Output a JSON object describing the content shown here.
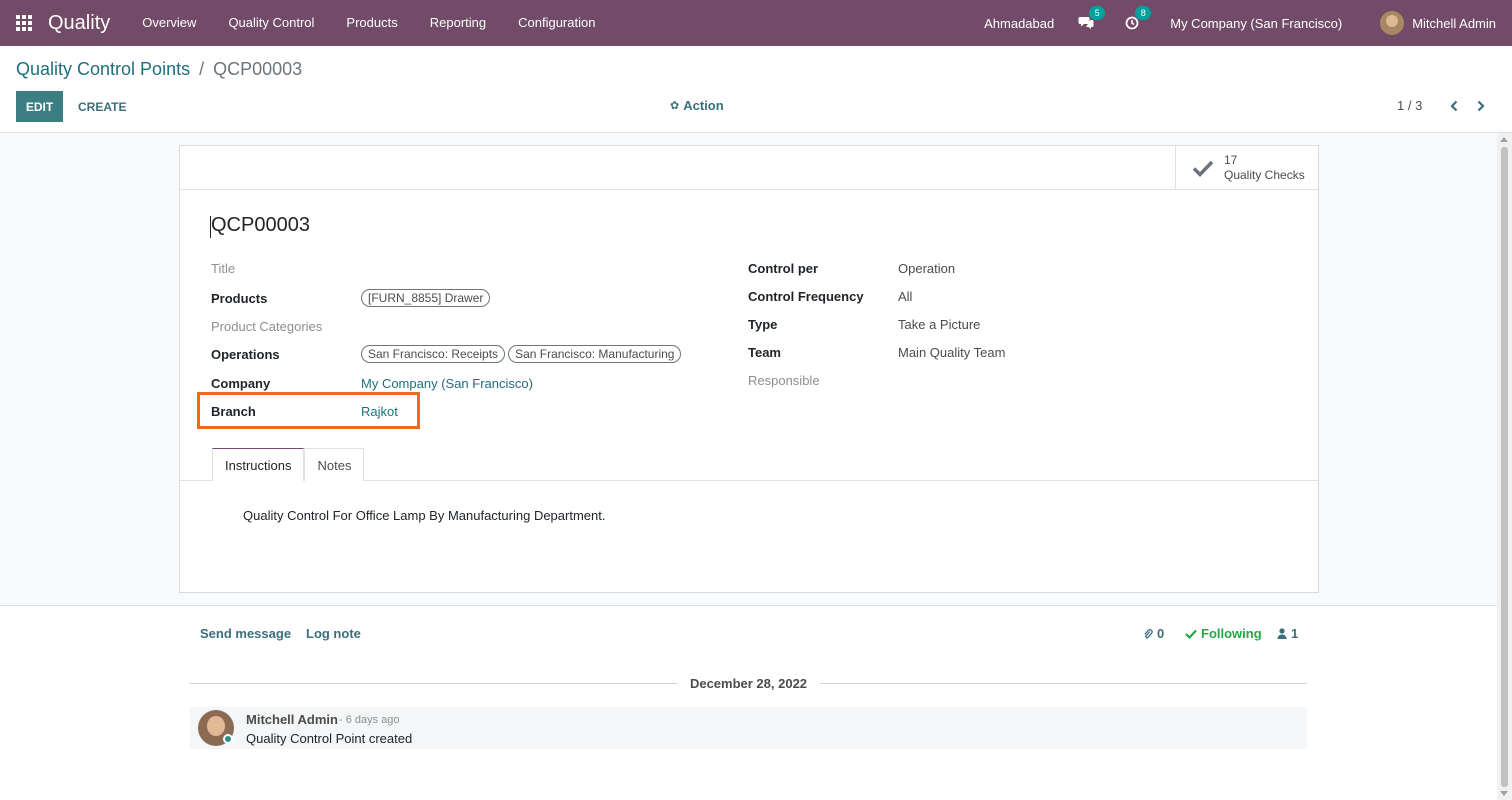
{
  "navbar": {
    "app_name": "Quality",
    "menu": [
      "Overview",
      "Quality Control",
      "Products",
      "Reporting",
      "Configuration"
    ],
    "branch": "Ahmadabad",
    "messages_count": "5",
    "activities_count": "8",
    "company": "My Company (San Francisco)",
    "user": "Mitchell Admin"
  },
  "control_panel": {
    "breadcrumb_parent": "Quality Control Points",
    "breadcrumb_sep": "/",
    "breadcrumb_current": "QCP00003",
    "edit_label": "EDIT",
    "create_label": "CREATE",
    "action_label": "Action",
    "pager": "1 / 3"
  },
  "stat_button": {
    "count": "17",
    "label": "Quality Checks"
  },
  "record": {
    "name": "QCP00003",
    "left_fields": {
      "title_label": "Title",
      "products_label": "Products",
      "products_tags": [
        "[FURN_8855] Drawer"
      ],
      "categories_label": "Product Categories",
      "operations_label": "Operations",
      "operations_tags": [
        "San Francisco: Receipts",
        "San Francisco: Manufacturing"
      ],
      "company_label": "Company",
      "company_value": "My Company (San Francisco)",
      "branch_label": "Branch",
      "branch_value": "Rajkot"
    },
    "right_fields": {
      "control_per_label": "Control per",
      "control_per_value": "Operation",
      "frequency_label": "Control Frequency",
      "frequency_value": "All",
      "type_label": "Type",
      "type_value": "Take a Picture",
      "team_label": "Team",
      "team_value": "Main Quality Team",
      "responsible_label": "Responsible"
    },
    "tabs": [
      "Instructions",
      "Notes"
    ],
    "instructions": "Quality Control For Office Lamp By Manufacturing Department."
  },
  "chatter": {
    "send_message": "Send message",
    "log_note": "Log note",
    "attachments": "0",
    "following": "Following",
    "followers": "1",
    "date": "December 28, 2022",
    "message": {
      "author": "Mitchell Admin",
      "time": "- 6 days ago",
      "body": "Quality Control Point created"
    }
  },
  "colors": {
    "navbar": "#714b67",
    "accent": "#3b7f85",
    "highlight": "#f06a1d",
    "following": "#28a745"
  }
}
